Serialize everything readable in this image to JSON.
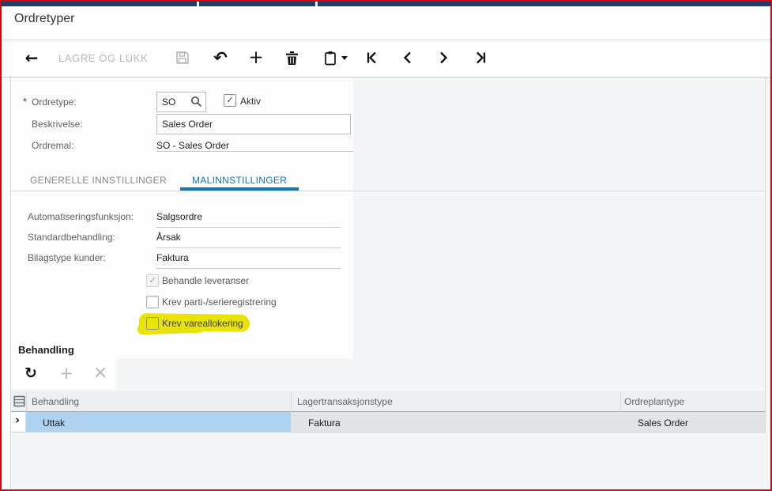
{
  "app": {
    "title": "Ordretyper"
  },
  "icons": {
    "back": "←",
    "undo": "↶",
    "add": "+",
    "refresh": "↻",
    "close": "×",
    "check": "✓",
    "row_pointer": "›"
  },
  "toolbar": {
    "save_and_close_label": "LAGRE OG LUKK"
  },
  "form": {
    "required_marker": "*",
    "ordretype": {
      "label": "Ordretype:",
      "value": "SO"
    },
    "aktiv": {
      "label": "Aktiv",
      "checked": true
    },
    "beskrivelse": {
      "label": "Beskrivelse:",
      "value": "Sales Order"
    },
    "ordremal": {
      "label": "Ordremal:",
      "value": "SO - Sales Order"
    }
  },
  "tabs": [
    {
      "label": "GENERELLE INNSTILLINGER",
      "active": false
    },
    {
      "label": "MALINNSTILLINGER",
      "active": true
    }
  ],
  "tab_fields": [
    {
      "label": "Automatiseringsfunksjon:",
      "value": "Salgsordre"
    },
    {
      "label": "Standardbehandling:",
      "value": "Årsak"
    },
    {
      "label": "Bilagstype kunder:",
      "value": "Faktura"
    }
  ],
  "checkboxes": [
    {
      "label": "Behandle leveranser",
      "checked": true,
      "disabled": true
    },
    {
      "label": "Krev parti-/serieregistrering",
      "checked": false,
      "disabled": false
    },
    {
      "label": "Krev vareallokering",
      "checked": false,
      "disabled": false,
      "highlighted": true
    }
  ],
  "grid": {
    "section_title": "Behandling",
    "columns": [
      "Behandling",
      "Lagertransaksjonstype",
      "Ordreplantype"
    ],
    "rows": [
      [
        "Uttak",
        "Faktura",
        "Sales Order"
      ]
    ]
  },
  "colors": {
    "accent_blue": "#1474b8",
    "selected_cell": "#aed3f1",
    "selected_row": "#e2e4e6",
    "highlight_yellow": "#eae307",
    "top_bar_navy": "#1d3d6d",
    "annotation_red": "#cf0a0a"
  }
}
